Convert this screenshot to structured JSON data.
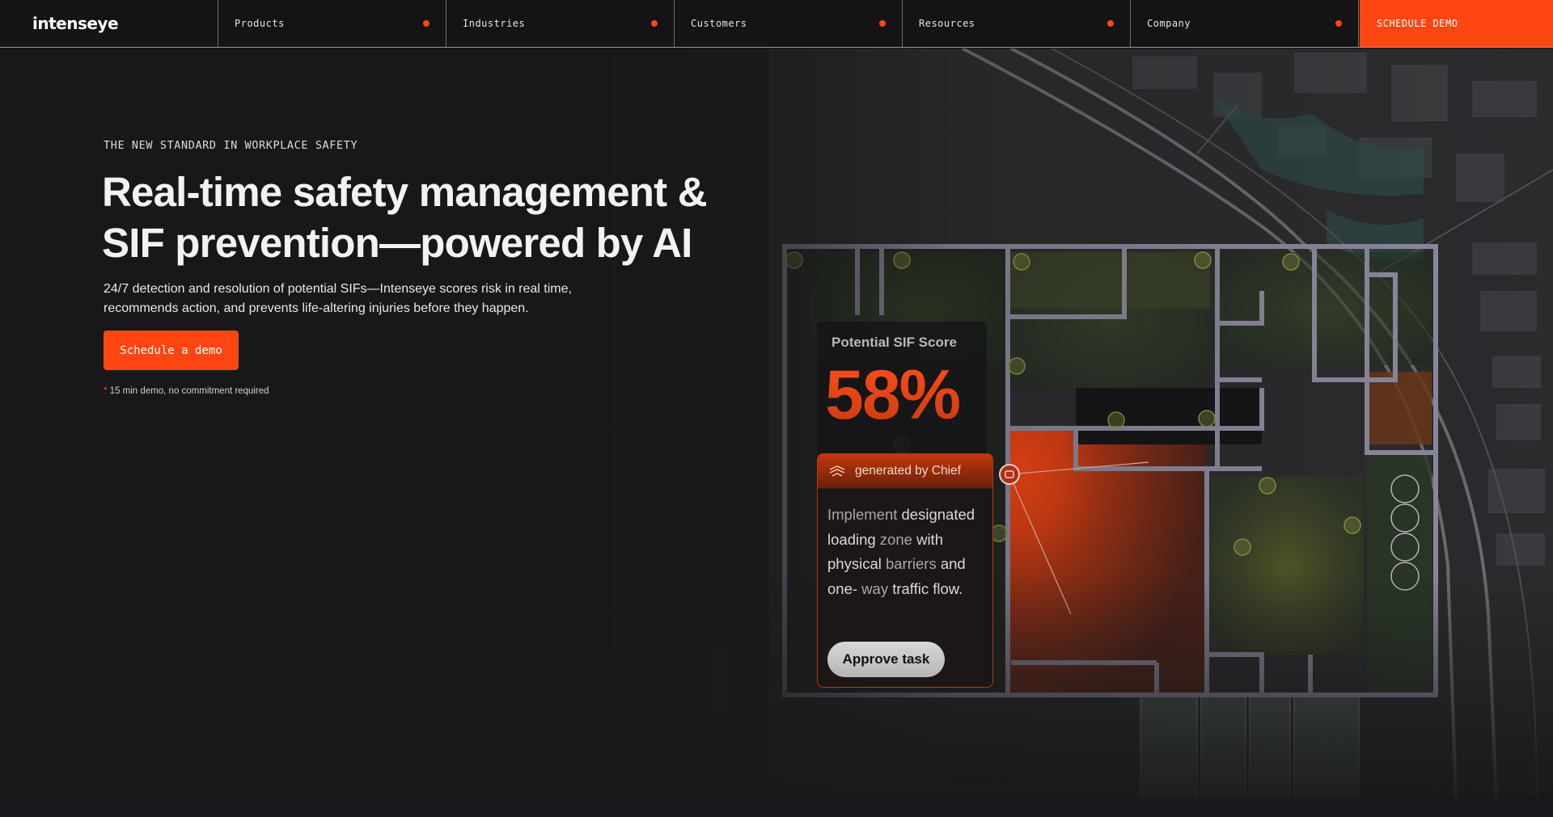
{
  "brand": {
    "name": "intenseye",
    "accent": "#ff4512"
  },
  "nav": {
    "items": [
      {
        "label": "Products"
      },
      {
        "label": "Industries"
      },
      {
        "label": "Customers"
      },
      {
        "label": "Resources"
      },
      {
        "label": "Company"
      }
    ],
    "cta_label": "SCHEDULE DEMO"
  },
  "hero": {
    "eyebrow": "THE NEW STANDARD IN WORKPLACE SAFETY",
    "headline_line1": "Real-time safety management &",
    "headline_line2": "SIF prevention—powered by AI",
    "subtext_line1": "24/7 detection and resolution of potential SIFs—Intenseye scores risk in real time,",
    "subtext_line2": "recommends action, and prevents life-altering injuries before they happen.",
    "cta_label": "Schedule a demo",
    "note_star": "*",
    "note": " 15 min demo, no commitment required"
  },
  "sif_card": {
    "title": "Potential SIF Score",
    "value": "58%"
  },
  "chief_card": {
    "label": "generated by Chief",
    "body_segments": [
      {
        "text": "Implement ",
        "style": "dim"
      },
      {
        "text": "designated loading",
        "style": "hl"
      },
      {
        "text": " zone ",
        "style": "dim"
      },
      {
        "text": "with physical",
        "style": "hl"
      },
      {
        "text": " barriers ",
        "style": "dim"
      },
      {
        "text": "and one-",
        "style": "hl"
      },
      {
        "text": " way ",
        "style": "dim"
      },
      {
        "text": "traffic flow.",
        "style": "hl"
      }
    ],
    "button_label": "Approve task"
  },
  "icons": [
    "intenseye-logo",
    "nav-dot",
    "chief-icon",
    "camera-icon"
  ]
}
